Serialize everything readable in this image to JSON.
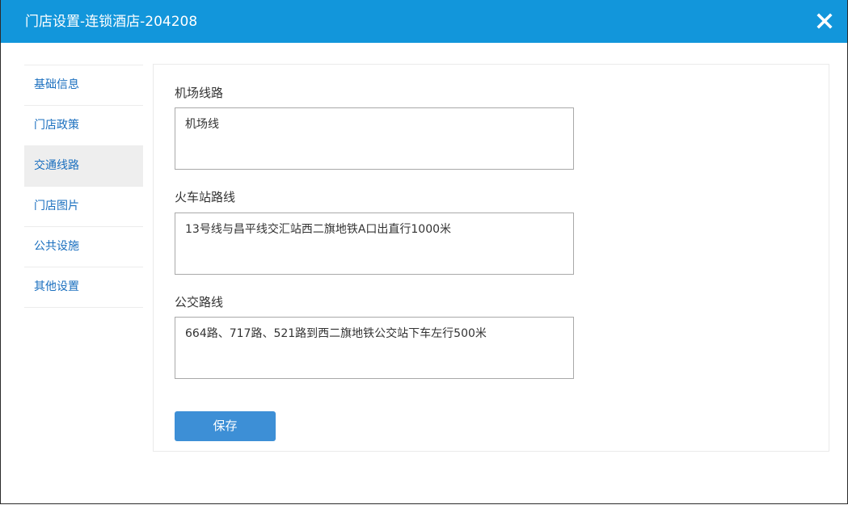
{
  "dialog": {
    "title": "门店设置-连锁酒店-204208",
    "close_icon": "close-icon",
    "colors": {
      "titlebar": "#1296db",
      "link": "#1a6fbf",
      "active_item_bg": "#eeeeee",
      "button": "#3d8fd6"
    }
  },
  "sidebar": {
    "items": [
      {
        "label": "基础信息",
        "active": false
      },
      {
        "label": "门店政策",
        "active": false
      },
      {
        "label": "交通线路",
        "active": true
      },
      {
        "label": "门店图片",
        "active": false
      },
      {
        "label": "公共设施",
        "active": false
      },
      {
        "label": "其他设置",
        "active": false
      }
    ]
  },
  "form": {
    "fields": [
      {
        "label": "机场线路",
        "value": "机场线"
      },
      {
        "label": "火车站路线",
        "value": "13号线与昌平线交汇站西二旗地铁A口出直行1000米"
      },
      {
        "label": "公交路线",
        "value": "664路、717路、521路到西二旗地铁公交站下车左行500米"
      }
    ],
    "save_label": "保存"
  }
}
